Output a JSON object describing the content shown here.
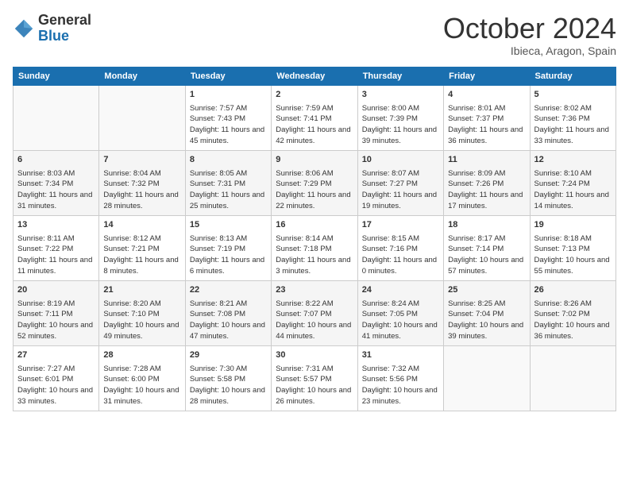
{
  "header": {
    "logo_line1": "General",
    "logo_line2": "Blue",
    "month": "October 2024",
    "location": "Ibieca, Aragon, Spain"
  },
  "weekdays": [
    "Sunday",
    "Monday",
    "Tuesday",
    "Wednesday",
    "Thursday",
    "Friday",
    "Saturday"
  ],
  "weeks": [
    [
      {
        "day": "",
        "content": ""
      },
      {
        "day": "",
        "content": ""
      },
      {
        "day": "1",
        "content": "Sunrise: 7:57 AM\nSunset: 7:43 PM\nDaylight: 11 hours and 45 minutes."
      },
      {
        "day": "2",
        "content": "Sunrise: 7:59 AM\nSunset: 7:41 PM\nDaylight: 11 hours and 42 minutes."
      },
      {
        "day": "3",
        "content": "Sunrise: 8:00 AM\nSunset: 7:39 PM\nDaylight: 11 hours and 39 minutes."
      },
      {
        "day": "4",
        "content": "Sunrise: 8:01 AM\nSunset: 7:37 PM\nDaylight: 11 hours and 36 minutes."
      },
      {
        "day": "5",
        "content": "Sunrise: 8:02 AM\nSunset: 7:36 PM\nDaylight: 11 hours and 33 minutes."
      }
    ],
    [
      {
        "day": "6",
        "content": "Sunrise: 8:03 AM\nSunset: 7:34 PM\nDaylight: 11 hours and 31 minutes."
      },
      {
        "day": "7",
        "content": "Sunrise: 8:04 AM\nSunset: 7:32 PM\nDaylight: 11 hours and 28 minutes."
      },
      {
        "day": "8",
        "content": "Sunrise: 8:05 AM\nSunset: 7:31 PM\nDaylight: 11 hours and 25 minutes."
      },
      {
        "day": "9",
        "content": "Sunrise: 8:06 AM\nSunset: 7:29 PM\nDaylight: 11 hours and 22 minutes."
      },
      {
        "day": "10",
        "content": "Sunrise: 8:07 AM\nSunset: 7:27 PM\nDaylight: 11 hours and 19 minutes."
      },
      {
        "day": "11",
        "content": "Sunrise: 8:09 AM\nSunset: 7:26 PM\nDaylight: 11 hours and 17 minutes."
      },
      {
        "day": "12",
        "content": "Sunrise: 8:10 AM\nSunset: 7:24 PM\nDaylight: 11 hours and 14 minutes."
      }
    ],
    [
      {
        "day": "13",
        "content": "Sunrise: 8:11 AM\nSunset: 7:22 PM\nDaylight: 11 hours and 11 minutes."
      },
      {
        "day": "14",
        "content": "Sunrise: 8:12 AM\nSunset: 7:21 PM\nDaylight: 11 hours and 8 minutes."
      },
      {
        "day": "15",
        "content": "Sunrise: 8:13 AM\nSunset: 7:19 PM\nDaylight: 11 hours and 6 minutes."
      },
      {
        "day": "16",
        "content": "Sunrise: 8:14 AM\nSunset: 7:18 PM\nDaylight: 11 hours and 3 minutes."
      },
      {
        "day": "17",
        "content": "Sunrise: 8:15 AM\nSunset: 7:16 PM\nDaylight: 11 hours and 0 minutes."
      },
      {
        "day": "18",
        "content": "Sunrise: 8:17 AM\nSunset: 7:14 PM\nDaylight: 10 hours and 57 minutes."
      },
      {
        "day": "19",
        "content": "Sunrise: 8:18 AM\nSunset: 7:13 PM\nDaylight: 10 hours and 55 minutes."
      }
    ],
    [
      {
        "day": "20",
        "content": "Sunrise: 8:19 AM\nSunset: 7:11 PM\nDaylight: 10 hours and 52 minutes."
      },
      {
        "day": "21",
        "content": "Sunrise: 8:20 AM\nSunset: 7:10 PM\nDaylight: 10 hours and 49 minutes."
      },
      {
        "day": "22",
        "content": "Sunrise: 8:21 AM\nSunset: 7:08 PM\nDaylight: 10 hours and 47 minutes."
      },
      {
        "day": "23",
        "content": "Sunrise: 8:22 AM\nSunset: 7:07 PM\nDaylight: 10 hours and 44 minutes."
      },
      {
        "day": "24",
        "content": "Sunrise: 8:24 AM\nSunset: 7:05 PM\nDaylight: 10 hours and 41 minutes."
      },
      {
        "day": "25",
        "content": "Sunrise: 8:25 AM\nSunset: 7:04 PM\nDaylight: 10 hours and 39 minutes."
      },
      {
        "day": "26",
        "content": "Sunrise: 8:26 AM\nSunset: 7:02 PM\nDaylight: 10 hours and 36 minutes."
      }
    ],
    [
      {
        "day": "27",
        "content": "Sunrise: 7:27 AM\nSunset: 6:01 PM\nDaylight: 10 hours and 33 minutes."
      },
      {
        "day": "28",
        "content": "Sunrise: 7:28 AM\nSunset: 6:00 PM\nDaylight: 10 hours and 31 minutes."
      },
      {
        "day": "29",
        "content": "Sunrise: 7:30 AM\nSunset: 5:58 PM\nDaylight: 10 hours and 28 minutes."
      },
      {
        "day": "30",
        "content": "Sunrise: 7:31 AM\nSunset: 5:57 PM\nDaylight: 10 hours and 26 minutes."
      },
      {
        "day": "31",
        "content": "Sunrise: 7:32 AM\nSunset: 5:56 PM\nDaylight: 10 hours and 23 minutes."
      },
      {
        "day": "",
        "content": ""
      },
      {
        "day": "",
        "content": ""
      }
    ]
  ]
}
